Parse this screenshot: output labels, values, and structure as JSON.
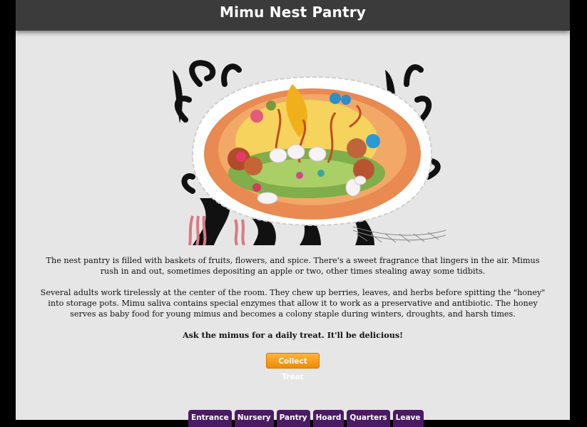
{
  "header": {
    "title": "Mimu Nest Pantry"
  },
  "description": {
    "paragraph_1": "The nest pantry is filled with baskets of fruits, flowers, and spice. There's a sweet fragrance that lingers in the air. Mimus rush in and out, sometimes depositing an apple or two, other times stealing away some tidbits.",
    "paragraph_2": "Several adults work tirelessly at the center of the room. They chew up berries, leaves, and herbs before spitting the \"honey\" into storage pots. Mimu saliva contains special enzymes that allow it to work as a preservative and antibiotic. The honey serves as baby food for young mimus and becomes a colony staple during winters, droughts, and harsh times.",
    "prompt": "Ask the mimus for a daily treat. It'll be delicious!"
  },
  "action": {
    "collect_label": "Collect Treat"
  },
  "nav": {
    "items": [
      {
        "label": "Entrance"
      },
      {
        "label": "Nursery"
      },
      {
        "label": "Pantry"
      },
      {
        "label": "Hoard"
      },
      {
        "label": "Quarters"
      },
      {
        "label": "Leave"
      }
    ]
  },
  "colors": {
    "header_bg": "#3b3b3b",
    "panel_bg": "#e6e6e6",
    "button_orange": "#f08a06",
    "nav_purple": "#4a1a63"
  }
}
